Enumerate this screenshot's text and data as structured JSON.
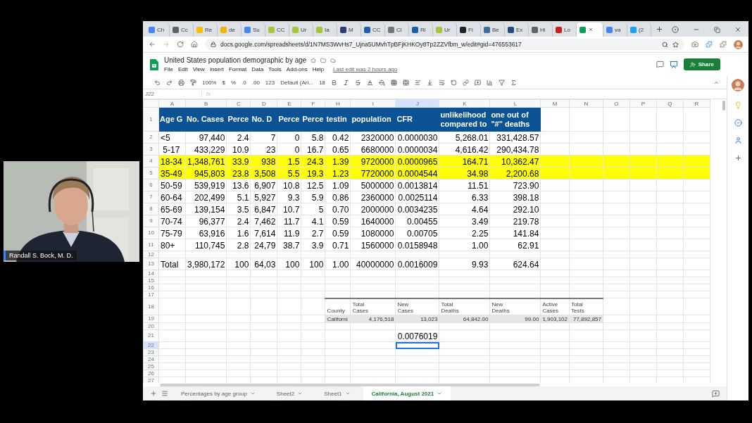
{
  "participant": {
    "name": "Randall S. Bock, M. D."
  },
  "browser": {
    "tabs": [
      {
        "title": "Ch",
        "color": "#4285f4",
        "selected": false
      },
      {
        "title": "Cc",
        "color": "#5f6368",
        "selected": false
      },
      {
        "title": "Re",
        "color": "#fbbc04",
        "selected": false
      },
      {
        "title": "de",
        "color": "#f4b400",
        "selected": false
      },
      {
        "title": "Su",
        "color": "#4285f4",
        "selected": false
      },
      {
        "title": "CC",
        "color": "#a4c639",
        "selected": false
      },
      {
        "title": "Ur",
        "color": "#a4c639",
        "selected": false
      },
      {
        "title": "Ia",
        "color": "#a4c639",
        "selected": false
      },
      {
        "title": "M",
        "color": "#2b3e75",
        "selected": false
      },
      {
        "title": "CC",
        "color": "#1a5fb4",
        "selected": false
      },
      {
        "title": "Cl",
        "color": "#70757a",
        "selected": false
      },
      {
        "title": "Ri",
        "color": "#1a5fb4",
        "selected": false
      },
      {
        "title": "Ur",
        "color": "#a4c639",
        "selected": false
      },
      {
        "title": "Fi",
        "color": "#202124",
        "selected": false
      },
      {
        "title": "Be",
        "color": "#3c6e9f",
        "selected": false
      },
      {
        "title": "Ex",
        "color": "#1f4e79",
        "selected": false
      },
      {
        "title": "Hi",
        "color": "#5f6368",
        "selected": false
      },
      {
        "title": "Lo",
        "color": "#c5221f",
        "selected": false
      },
      {
        "color": "#0f9d58",
        "selected": true
      },
      {
        "title": "va",
        "color": "#4285f4",
        "selected": false
      },
      {
        "title": "(2",
        "color": "#1da1f2",
        "selected": false
      }
    ],
    "url": "docs.google.com/spreadsheets/d/1N7MS3WvHs7_Ujna5UMvhTpBFjKHKOy8Tp2ZZVfbm_w/edit#gid=476553617"
  },
  "document": {
    "title": "United States population demographic by age",
    "menus": [
      "File",
      "Edit",
      "View",
      "Insert",
      "Format",
      "Data",
      "Tools",
      "Add-ons",
      "Help"
    ],
    "last_edit": "Last edit was 2 hours ago",
    "share": "Share"
  },
  "toolbar": {
    "zoom": "100%",
    "currency": "$",
    "percent": "%",
    "decrease_decimals": ".0",
    "increase_decimals": ".00",
    "number_format": "123",
    "font": "Default (Ari...",
    "font_size": "18"
  },
  "formula_bar": {
    "cell": "J22",
    "fx": "fx"
  },
  "grid": {
    "columns": [
      {
        "letter": "A",
        "selected": false
      },
      {
        "letter": "B",
        "selected": false
      },
      {
        "letter": "C",
        "selected": false
      },
      {
        "letter": "D",
        "selected": false
      },
      {
        "letter": "E",
        "selected": false
      },
      {
        "letter": "F",
        "selected": false
      },
      {
        "letter": "H",
        "selected": false
      },
      {
        "letter": "I",
        "selected": false
      },
      {
        "letter": "J",
        "selected": true
      },
      {
        "letter": "K",
        "selected": false
      },
      {
        "letter": "L",
        "selected": false
      },
      {
        "letter": "M",
        "selected": false
      },
      {
        "letter": "N",
        "selected": false
      },
      {
        "letter": "O",
        "selected": false
      },
      {
        "letter": "P",
        "selected": false
      },
      {
        "letter": "Q",
        "selected": false
      },
      {
        "letter": "R",
        "selected": false
      }
    ],
    "rows": [
      {
        "number": "1",
        "kind": "header",
        "cells": {
          "A": "Age G",
          "B": "No. Cases",
          "C": "Perce",
          "D": "No. D",
          "E": "Perce",
          "F": "Perce",
          "H": "testin",
          "I": "population",
          "J": "CFR",
          "K": "unlikelihood\ncompared to",
          "L": "one out of\n\"#\" deaths"
        }
      },
      {
        "number": "2",
        "kind": "data",
        "highlighted": false,
        "cells": {
          "A": "<5",
          "B": "97,440",
          "C": "2.4",
          "D": "7",
          "E": "0",
          "F": "5.8",
          "H": "0.42",
          "I": "2320000",
          "J": "0.0000030",
          "K": "5,268.01",
          "L": "331,428.57"
        }
      },
      {
        "number": "3",
        "kind": "data",
        "highlighted": false,
        "cells": {
          "A": " 5-17",
          "B": "433,229",
          "C": "10.9",
          "D": "23",
          "E": "0",
          "F": "16.7",
          "H": "0.65",
          "I": "6680000",
          "J": "0.0000034",
          "K": "4,616.42",
          "L": "290,434.78"
        }
      },
      {
        "number": "4",
        "kind": "data",
        "highlighted": true,
        "cells": {
          "A": "18-34",
          "B": "1,348,761",
          "C": "33.9",
          "D": "938",
          "E": "1.5",
          "F": "24.3",
          "H": "1.39",
          "I": "9720000",
          "J": "0.0000965",
          "K": "164.71",
          "L": "10,362.47"
        }
      },
      {
        "number": "5",
        "kind": "data",
        "highlighted": true,
        "cells": {
          "A": "35-49",
          "B": "945,803",
          "C": "23.8",
          "D": "3,508",
          "E": "5.5",
          "F": "19.3",
          "H": "1.23",
          "I": "7720000",
          "J": "0.0004544",
          "K": "34.98",
          "L": "2,200.68"
        }
      },
      {
        "number": "6",
        "kind": "data",
        "highlighted": false,
        "cells": {
          "A": "50-59",
          "B": "539,919",
          "C": "13.6",
          "D": "6,907",
          "E": "10.8",
          "F": "12.5",
          "H": "1.09",
          "I": "5000000",
          "J": "0.0013814",
          "K": "11.51",
          "L": "723.90"
        }
      },
      {
        "number": "7",
        "kind": "data",
        "highlighted": false,
        "cells": {
          "A": "60-64",
          "B": "202,499",
          "C": "5.1",
          "D": "5,927",
          "E": "9.3",
          "F": "5.9",
          "H": "0.86",
          "I": "2360000",
          "J": "0.0025114",
          "K": "6.33",
          "L": "398.18"
        }
      },
      {
        "number": "8",
        "kind": "data",
        "highlighted": false,
        "cells": {
          "A": "65-69",
          "B": "139,154",
          "C": "3.5",
          "D": "6,847",
          "E": "10.7",
          "F": "5",
          "H": "0.70",
          "I": "2000000",
          "J": "0.0034235",
          "K": "4.64",
          "L": "292.10"
        }
      },
      {
        "number": "9",
        "kind": "data",
        "highlighted": false,
        "cells": {
          "A": "70-74",
          "B": "96,377",
          "C": "2.4",
          "D": "7,462",
          "E": "11.7",
          "F": "4.1",
          "H": "0.59",
          "I": "1640000",
          "J": "0.00455",
          "K": "3.49",
          "L": "219.78"
        }
      },
      {
        "number": "10",
        "kind": "data",
        "highlighted": false,
        "cells": {
          "A": "75-79",
          "B": "63,916",
          "C": "1.6",
          "D": "7,614",
          "E": "11.9",
          "F": "2.7",
          "H": "0.59",
          "I": "1080000",
          "J": "0.00705",
          "K": "2.25",
          "L": "141.84"
        }
      },
      {
        "number": "11",
        "kind": "data",
        "highlighted": false,
        "cells": {
          "A": "80+",
          "B": "110,745",
          "C": "2.8",
          "D": "24,79",
          "E": "38.7",
          "F": "3.9",
          "H": "0.71",
          "I": "1560000",
          "J": "0.0158948",
          "K": "1.00",
          "L": "62.91"
        }
      },
      {
        "number": "12",
        "kind": "empty",
        "cells": {}
      },
      {
        "number": "13",
        "kind": "data",
        "highlighted": false,
        "cells": {
          "A": "Total",
          "B": "3,980,172",
          "C": "100",
          "D": "64,03",
          "E": "100",
          "F": "100",
          "H": "1.00",
          "I": "40000000",
          "J": "0.0016009",
          "K": "9.93",
          "L": "624.64"
        }
      },
      {
        "number": "14",
        "kind": "empty",
        "cells": {}
      },
      {
        "number": "15",
        "kind": "empty",
        "cells": {}
      },
      {
        "number": "16",
        "kind": "empty",
        "cells": {}
      },
      {
        "number": "17",
        "kind": "empty",
        "cells": {}
      },
      {
        "number": "18",
        "kind": "subheader",
        "cells": {
          "H": "County",
          "I": "Total\nCases",
          "J": "New\nCases",
          "K": "Total\nDeaths",
          "L": "New\nDeaths",
          "M": "Active\nCases",
          "N": "Total\nTests"
        }
      },
      {
        "number": "19",
        "kind": "subrow",
        "cells": {
          "H": "Californi",
          "I": "4,176,518",
          "J": "13,023",
          "K": "64,842.00",
          "L": "99.00",
          "M": "1,903,102",
          "N": "77,892,857"
        }
      },
      {
        "number": "20",
        "kind": "empty",
        "cells": {}
      },
      {
        "number": "21",
        "kind": "data",
        "highlighted": false,
        "cells": {
          "J": "0.0076019"
        }
      },
      {
        "number": "22",
        "kind": "empty",
        "selected": true,
        "cells": {}
      },
      {
        "number": "23",
        "kind": "empty",
        "cells": {}
      },
      {
        "number": "24",
        "kind": "empty",
        "cells": {}
      },
      {
        "number": "25",
        "kind": "empty",
        "cells": {}
      },
      {
        "number": "26",
        "kind": "empty",
        "cells": {}
      },
      {
        "number": "27",
        "kind": "empty",
        "cells": {}
      }
    ]
  },
  "sheet_tabs": [
    {
      "label": "Percentages by age group",
      "selected": false
    },
    {
      "label": "Sheet2",
      "selected": false
    },
    {
      "label": "Sheet1",
      "selected": false
    },
    {
      "label": "California, August 2021",
      "selected": true
    }
  ]
}
